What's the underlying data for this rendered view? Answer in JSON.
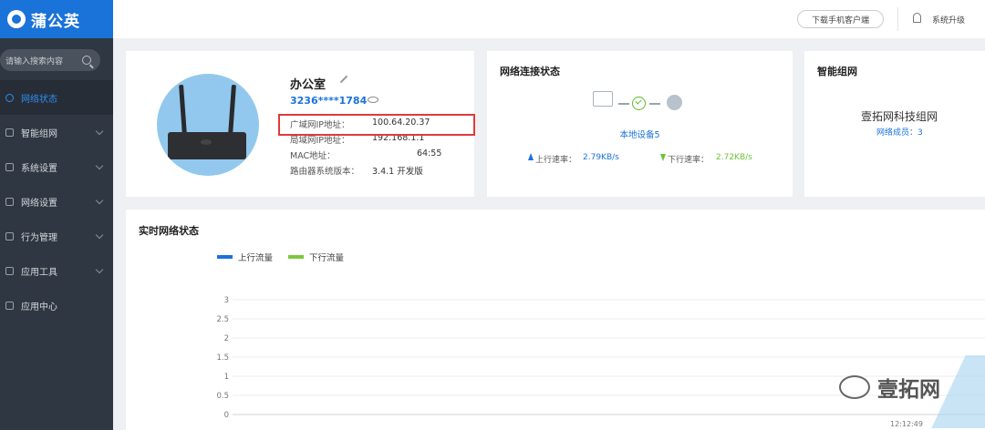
{
  "app": {
    "name": "蒲公英"
  },
  "sidebar": {
    "search_placeholder": "请输入搜索内容",
    "items": [
      {
        "label": "网络状态",
        "active": true
      },
      {
        "label": "智能组网"
      },
      {
        "label": "系统设置"
      },
      {
        "label": "网络设置"
      },
      {
        "label": "行为管理"
      },
      {
        "label": "应用工具"
      },
      {
        "label": "应用中心"
      }
    ]
  },
  "topbar": {
    "download_label": "下载手机客户端",
    "upgrade_label": "系统升级"
  },
  "router": {
    "name": "办公室",
    "id": "3236****1784",
    "rows": [
      {
        "label": "广域网IP地址：",
        "value": "100.64.20.37"
      },
      {
        "label": "局域网IP地址：",
        "value": "192.168.1.1"
      },
      {
        "label": "MAC地址：",
        "value": "64:55"
      },
      {
        "label": "路由器系统版本：",
        "value": "3.4.1 开发版"
      }
    ]
  },
  "network": {
    "title": "网络连接状态",
    "local_devices": "本地设备5",
    "up_label": "上行速率：",
    "up_rate": "2.79KB/s",
    "down_label": "下行速率：",
    "down_rate": "2.72KB/s"
  },
  "mesh": {
    "title": "智能组网",
    "name": "壹拓网科技组网",
    "members": "网络成员：3"
  },
  "chart_data": {
    "type": "line",
    "title": "实时网络状态",
    "series": [
      {
        "name": "上行流量",
        "color": "#1a73d9",
        "values": []
      },
      {
        "name": "下行流量",
        "color": "#7cc93c",
        "values": []
      }
    ],
    "y_ticks": [
      "3",
      "2.5",
      "2",
      "1.5",
      "1",
      "0.5",
      "0"
    ],
    "ylim": [
      0,
      3
    ],
    "x_ticks": [
      "12:12:49"
    ],
    "grid": true,
    "legend": "top-left"
  },
  "watermark": {
    "text": "壹拓网"
  },
  "colors": {
    "accent": "#1a73d9",
    "down": "#7cc93c",
    "highlight": "#e03a3a",
    "sidebar": "#2f3742"
  }
}
